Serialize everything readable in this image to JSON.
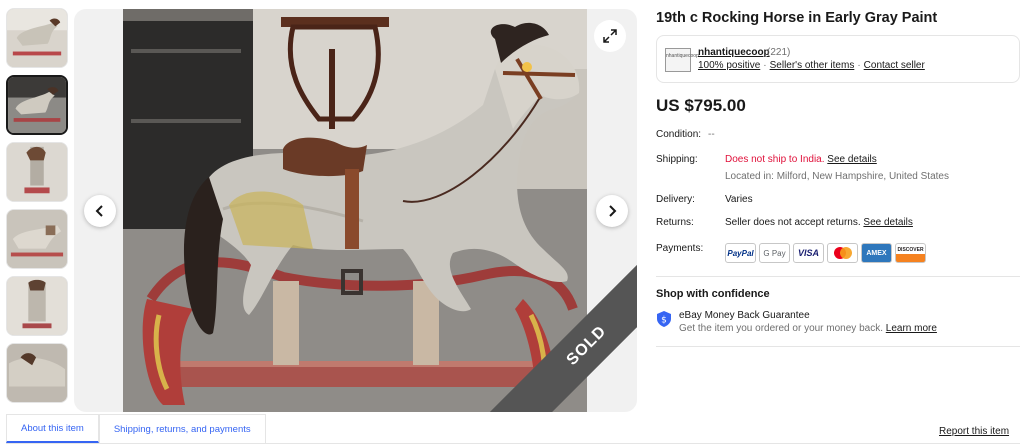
{
  "listing": {
    "title": "19th c Rocking Horse in Early Gray Paint",
    "price": "US $795.00",
    "sold_badge": "SOLD"
  },
  "seller": {
    "logo_text": "nhantiquecoop",
    "name": "nhantiquecoop",
    "feedback_count": "(221)",
    "positive": "100% positive",
    "other_items": "Seller's other items",
    "contact": "Contact seller"
  },
  "details": {
    "condition_label": "Condition:",
    "condition_value": "--",
    "shipping_label": "Shipping:",
    "shipping_value": "Does not ship to India.",
    "shipping_link": "See details",
    "location": "Located in: Milford, New Hampshire, United States",
    "delivery_label": "Delivery:",
    "delivery_value": "Varies",
    "returns_label": "Returns:",
    "returns_value": "Seller does not accept returns.",
    "returns_link": "See details",
    "payments_label": "Payments:"
  },
  "payments": [
    {
      "name": "PayPal",
      "color": "#003087"
    },
    {
      "name": "G Pay",
      "color": "#5f6368"
    },
    {
      "name": "VISA",
      "color": "#1a1f71"
    },
    {
      "name": "",
      "color": "#eb001b"
    },
    {
      "name": "AMEX",
      "color": "#ffffff"
    },
    {
      "name": "DISCOVER",
      "color": "#f58220"
    }
  ],
  "confidence": {
    "title": "Shop with confidence",
    "guarantee": "eBay Money Back Guarantee",
    "guarantee_sub": "Get the item you ordered or your money back.",
    "learn_more": "Learn more"
  },
  "tabs": [
    {
      "label": "About this item",
      "active": true
    },
    {
      "label": "Shipping, returns, and payments",
      "active": false
    }
  ],
  "report": "Report this item",
  "colors": {
    "accent_blue": "#3665f3",
    "alert_red": "#e0103a",
    "text": "#191919",
    "muted": "#707070"
  }
}
